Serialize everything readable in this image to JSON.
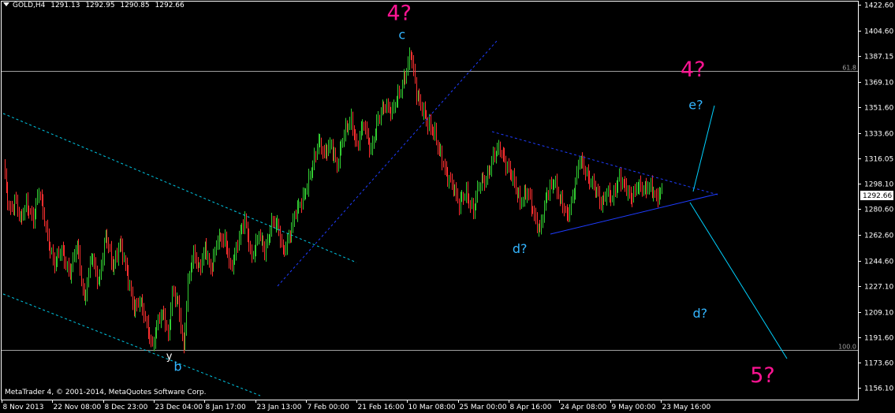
{
  "header": {
    "symbol": "GOLD,H4",
    "open": "1291.13",
    "high": "1292.95",
    "low": "1290.85",
    "close": "1292.66"
  },
  "footer": {
    "copyright": "MetaTrader 4, © 2001-2014, MetaQuotes Software Corp."
  },
  "colors": {
    "background": "#000000",
    "axis": "#ffffff",
    "bull": "#32cd32",
    "bear": "#ff3030",
    "channel": "#00c8e6",
    "triangle": "#1e3cff",
    "projection": "#00d2ff",
    "wave_major": "#ff1493",
    "wave_minor": "#33b5ff",
    "level_line": "#a0a0a0",
    "price_tag_bg": "#ffffff",
    "price_tag_fg": "#000000"
  },
  "chart_data": {
    "type": "candlestick",
    "ylim": [
      1148,
      1425
    ],
    "y_ticks": [
      "1422.60",
      "1404.60",
      "1387.15",
      "1369.10",
      "1351.60",
      "1333.60",
      "1316.05",
      "1298.10",
      "1280.60",
      "1262.60",
      "1244.60",
      "1227.10",
      "1209.10",
      "1191.60",
      "1173.60",
      "1156.10"
    ],
    "x_ticks": [
      "8 Nov 2013",
      "22 Nov 08:00",
      "8 Dec 23:00",
      "23 Dec 04:00",
      "8 Jan 17:00",
      "23 Jan 13:00",
      "7 Feb 00:00",
      "21 Feb 16:00",
      "10 Mar 08:00",
      "25 Mar 00:00",
      "8 Apr 16:00",
      "24 Apr 08:00",
      "9 May 00:00",
      "23 May 16:00"
    ],
    "current_price": "1292.66",
    "levels": [
      {
        "label": "61.8",
        "price": 1376.5
      },
      {
        "label": "100.0",
        "price": 1182.5
      }
    ],
    "price_path": [
      [
        0,
        1310
      ],
      [
        4,
        1278
      ],
      [
        9,
        1288
      ],
      [
        12,
        1272
      ],
      [
        16,
        1283
      ],
      [
        21,
        1275
      ],
      [
        25,
        1293
      ],
      [
        31,
        1262
      ],
      [
        36,
        1242
      ],
      [
        41,
        1252
      ],
      [
        47,
        1236
      ],
      [
        52,
        1255
      ],
      [
        57,
        1218
      ],
      [
        62,
        1247
      ],
      [
        67,
        1230
      ],
      [
        72,
        1262
      ],
      [
        77,
        1240
      ],
      [
        82,
        1258
      ],
      [
        87,
        1235
      ],
      [
        92,
        1213
      ],
      [
        96,
        1216
      ],
      [
        101,
        1200
      ],
      [
        105,
        1186
      ],
      [
        109,
        1202
      ],
      [
        113,
        1208
      ],
      [
        116,
        1193
      ],
      [
        119,
        1222
      ],
      [
        123,
        1214
      ],
      [
        127,
        1185
      ],
      [
        130,
        1230
      ],
      [
        134,
        1248
      ],
      [
        138,
        1240
      ],
      [
        142,
        1254
      ],
      [
        146,
        1236
      ],
      [
        151,
        1262
      ],
      [
        156,
        1258
      ],
      [
        160,
        1239
      ],
      [
        165,
        1258
      ],
      [
        170,
        1272
      ],
      [
        175,
        1248
      ],
      [
        180,
        1262
      ],
      [
        184,
        1251
      ],
      [
        189,
        1272
      ],
      [
        193,
        1268
      ],
      [
        197,
        1252
      ],
      [
        203,
        1266
      ],
      [
        206,
        1278
      ],
      [
        211,
        1290
      ],
      [
        214,
        1296
      ],
      [
        218,
        1310
      ],
      [
        222,
        1330
      ],
      [
        226,
        1318
      ],
      [
        231,
        1325
      ],
      [
        235,
        1312
      ],
      [
        240,
        1332
      ],
      [
        245,
        1344
      ],
      [
        249,
        1324
      ],
      [
        254,
        1340
      ],
      [
        259,
        1322
      ],
      [
        264,
        1342
      ],
      [
        269,
        1355
      ],
      [
        274,
        1347
      ],
      [
        279,
        1362
      ],
      [
        284,
        1378
      ],
      [
        287,
        1388
      ],
      [
        291,
        1362
      ],
      [
        295,
        1352
      ],
      [
        299,
        1338
      ],
      [
        304,
        1334
      ],
      [
        308,
        1318
      ],
      [
        312,
        1303
      ],
      [
        317,
        1298
      ],
      [
        321,
        1283
      ],
      [
        326,
        1292
      ],
      [
        331,
        1280
      ],
      [
        335,
        1296
      ],
      [
        340,
        1303
      ],
      [
        345,
        1316
      ],
      [
        350,
        1323
      ],
      [
        354,
        1313
      ],
      [
        359,
        1300
      ],
      [
        364,
        1287
      ],
      [
        369,
        1292
      ],
      [
        374,
        1276
      ],
      [
        378,
        1267
      ],
      [
        383,
        1290
      ],
      [
        388,
        1302
      ],
      [
        392,
        1287
      ],
      [
        397,
        1275
      ],
      [
        401,
        1290
      ],
      [
        406,
        1314
      ],
      [
        411,
        1306
      ],
      [
        416,
        1296
      ],
      [
        421,
        1284
      ],
      [
        425,
        1294
      ],
      [
        429,
        1286
      ],
      [
        434,
        1304
      ],
      [
        438,
        1297
      ],
      [
        442,
        1286
      ],
      [
        447,
        1299
      ],
      [
        452,
        1293
      ],
      [
        456,
        1296
      ],
      [
        460,
        1290
      ],
      [
        464,
        1292.66
      ]
    ],
    "labels": [
      {
        "text": "4?",
        "class": "major",
        "index": 279,
        "price": 1412
      },
      {
        "text": "c",
        "class": "minor",
        "index": 281,
        "price": 1399
      },
      {
        "text": "4?",
        "class": "major",
        "index": 486,
        "price": 1373
      },
      {
        "text": "e?",
        "class": "minor",
        "index": 488,
        "price": 1350
      },
      {
        "text": "d?",
        "class": "minor",
        "index": 364,
        "price": 1250
      },
      {
        "text": "d?",
        "class": "minor",
        "index": 491,
        "price": 1205
      },
      {
        "text": "5?",
        "class": "major",
        "index": 535,
        "price": 1160
      },
      {
        "text": "y",
        "class": "plain",
        "index": 117,
        "price": 1176
      },
      {
        "text": "b",
        "class": "minor",
        "index": 123,
        "price": 1168
      }
    ]
  }
}
